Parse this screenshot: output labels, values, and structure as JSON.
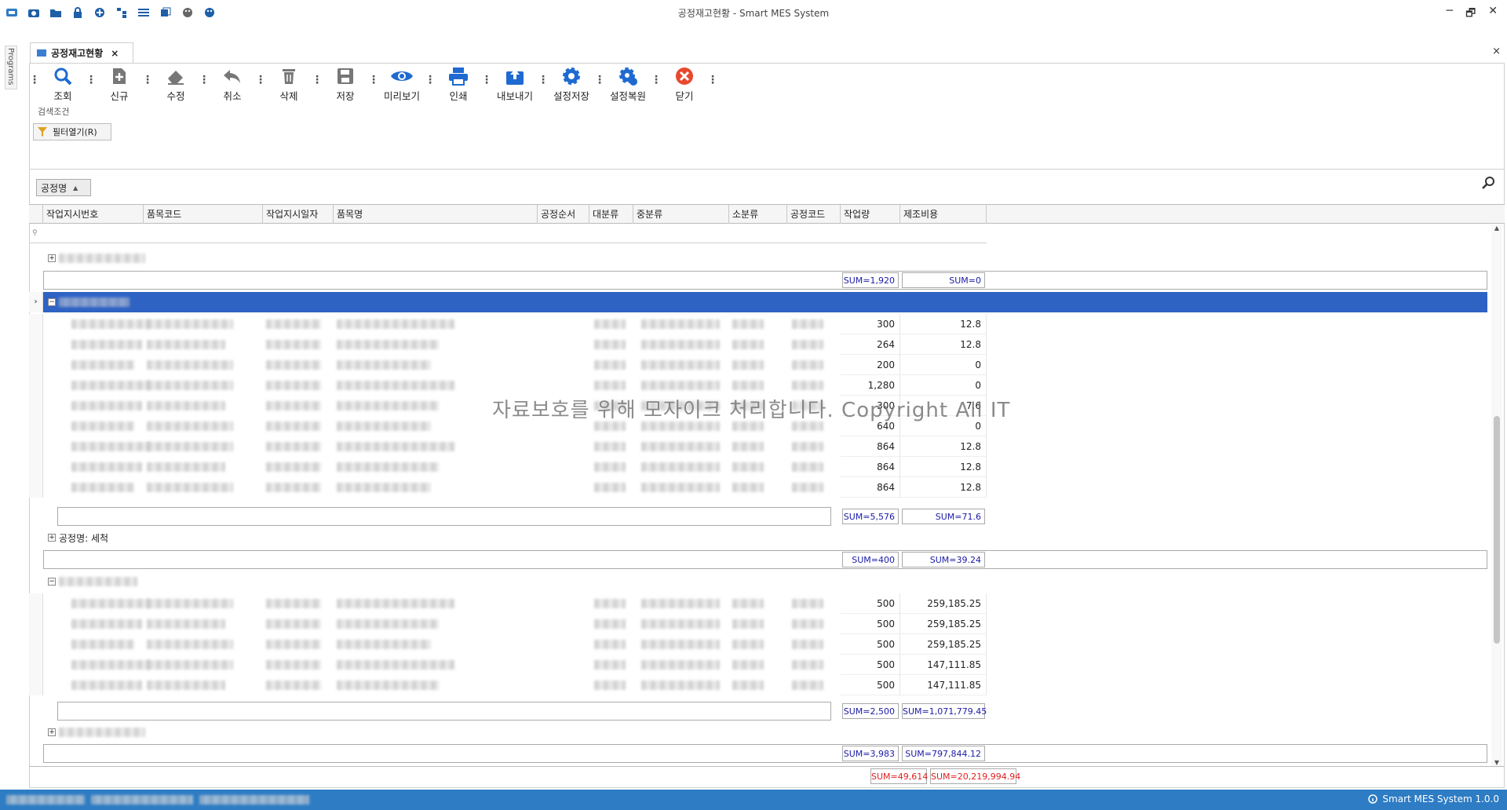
{
  "window": {
    "title": "공정재고현황 - Smart MES System",
    "controls": [
      "─",
      "🗗",
      "✕"
    ]
  },
  "sidebar": {
    "label": "Programs"
  },
  "tab": {
    "label": "공정재고현황",
    "close": "×"
  },
  "main_close": "×",
  "toolbar": {
    "search": "조회",
    "new": "신규",
    "edit": "수정",
    "cancel": "취소",
    "delete": "삭제",
    "save": "저장",
    "preview": "미리보기",
    "print": "인쇄",
    "export": "내보내기",
    "save_settings": "설정저장",
    "restore_settings": "설정복원",
    "close": "닫기"
  },
  "search_section": {
    "label": "검색조건",
    "filter_button": "필터열기(R)"
  },
  "group_panel": {
    "chip": "공정명"
  },
  "grid": {
    "columns": [
      "작업지시번호",
      "품목코드",
      "작업지시일자",
      "품목명",
      "공정순서",
      "대분류",
      "중분류",
      "소분류",
      "공정코드",
      "작업량",
      "제조비용"
    ],
    "group1": {
      "sum_qty": "SUM=1,920",
      "sum_cost": "SUM=0"
    },
    "group2": {
      "rows": [
        {
          "qty": "300",
          "cost": "12.8"
        },
        {
          "qty": "264",
          "cost": "12.8"
        },
        {
          "qty": "200",
          "cost": "0"
        },
        {
          "qty": "1,280",
          "cost": "0"
        },
        {
          "qty": "300",
          "cost": "7.6"
        },
        {
          "qty": "640",
          "cost": "0"
        },
        {
          "qty": "864",
          "cost": "12.8"
        },
        {
          "qty": "864",
          "cost": "12.8"
        },
        {
          "qty": "864",
          "cost": "12.8"
        }
      ],
      "sum_qty": "SUM=5,576",
      "sum_cost": "SUM=71.6"
    },
    "group3": {
      "label": "공정명: 세척",
      "sum_qty": "SUM=400",
      "sum_cost": "SUM=39.24"
    },
    "group4": {
      "rows": [
        {
          "qty": "500",
          "cost": "259,185.25"
        },
        {
          "qty": "500",
          "cost": "259,185.25"
        },
        {
          "qty": "500",
          "cost": "259,185.25"
        },
        {
          "qty": "500",
          "cost": "147,111.85"
        },
        {
          "qty": "500",
          "cost": "147,111.85"
        }
      ],
      "sum_qty": "SUM=2,500",
      "sum_cost": "SUM=1,071,779.45"
    },
    "group5": {
      "sum_qty": "SUM=3,983",
      "sum_cost": "SUM=797,844.12"
    },
    "total": {
      "sum_qty": "SUM=49,614",
      "sum_cost": "SUM=20,219,994.94"
    }
  },
  "watermark": "자료보호를 위해 모자이크 처리합니다. Copyright All IT",
  "statusbar": {
    "app": "Smart MES System 1.0.0"
  },
  "colors": {
    "status_bar": "#2d7cc4",
    "selected_row": "#2e63c4",
    "sum_text": "#1a1aa6",
    "total_text": "#e02020"
  }
}
